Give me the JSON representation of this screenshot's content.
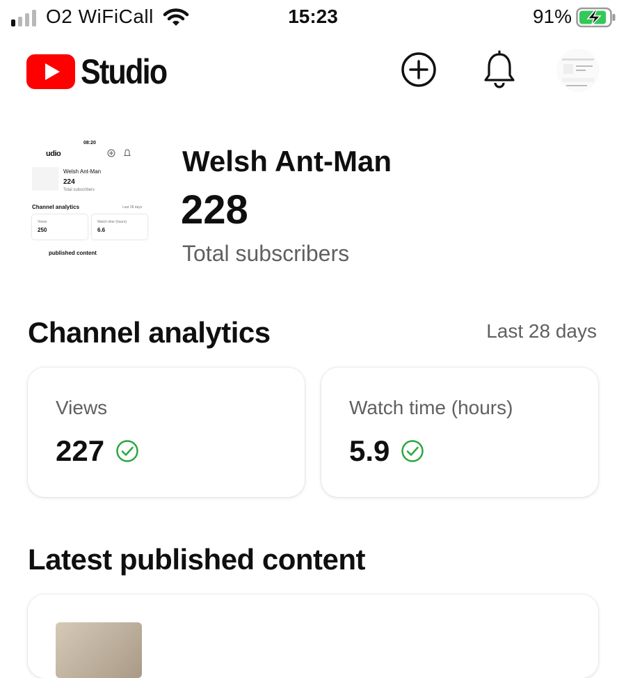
{
  "status_bar": {
    "carrier": "O2 WiFiCall",
    "time": "15:23",
    "battery_percent": "91%",
    "battery_level": 0.91,
    "signal_bars_active": 1,
    "charging": true
  },
  "header": {
    "logo_text": "Studio",
    "create_icon": "plus-circle-icon",
    "notifications_icon": "bell-icon",
    "brand_color": "#ff0000"
  },
  "channel": {
    "name": "Welsh Ant-Man",
    "subscriber_count": "228",
    "subscriber_label": "Total subscribers",
    "thumbnail": {
      "time": "08:20",
      "logo_text": "udio",
      "name": "Welsh Ant-Man",
      "count": "224",
      "label": "Total subscribers",
      "analytics_title": "Channel analytics",
      "period": "Last 28 days",
      "views_label": "Views",
      "views_value": "250",
      "watch_label": "Watch time (hours)",
      "watch_value": "6.6",
      "latest_title": "published content"
    }
  },
  "analytics": {
    "title": "Channel analytics",
    "period": "Last 28 days",
    "cards": [
      {
        "label": "Views",
        "value": "227",
        "status_icon": "check-circle-icon"
      },
      {
        "label": "Watch time (hours)",
        "value": "5.9",
        "status_icon": "check-circle-icon"
      }
    ],
    "check_color": "#2ba640"
  },
  "latest": {
    "title": "Latest published content"
  }
}
